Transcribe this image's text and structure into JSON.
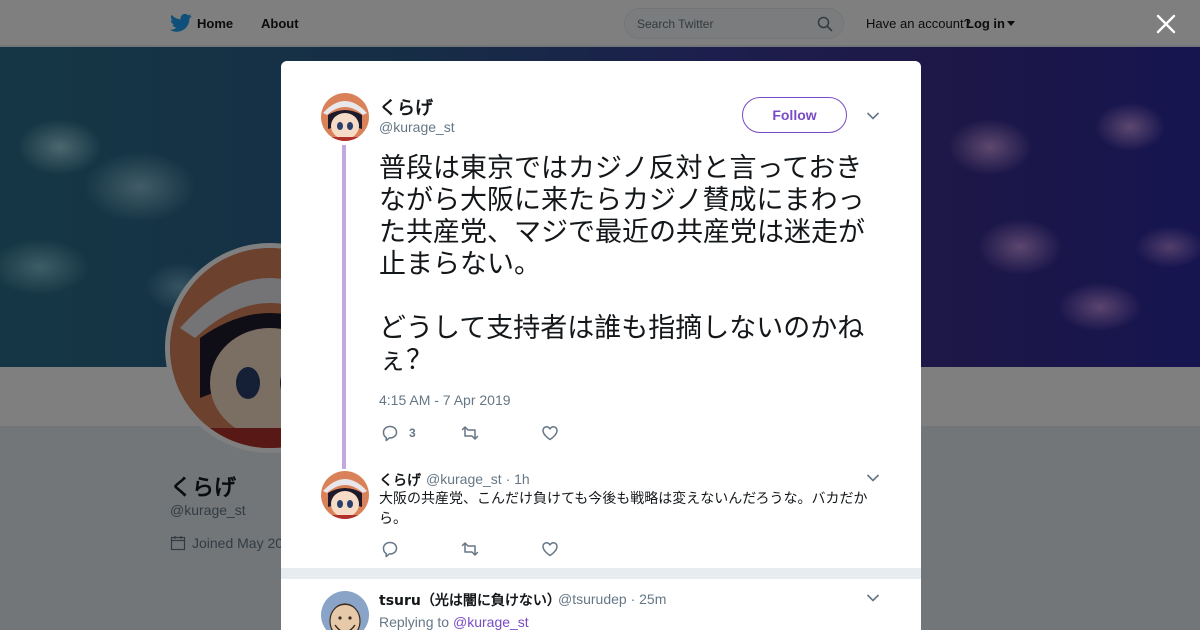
{
  "nav": {
    "home_label": "Home",
    "about_label": "About",
    "search_placeholder": "Search Twitter",
    "have_account": "Have an account?",
    "login_label": "Log in"
  },
  "profile": {
    "name": "くらげ",
    "handle": "@kurage_st",
    "joined": "Joined May 20"
  },
  "tweet": {
    "author_name": "くらげ",
    "author_handle": "@kurage_st",
    "follow_label": "Follow",
    "paragraph1": "普段は東京ではカジノ反対と言っておきながら大阪に来たらカジノ賛成にまわった共産党、マジで最近の共産党は迷走が止まらない。",
    "paragraph2": "どうして支持者は誰も指摘しないのかねぇ？",
    "timestamp": "4:15 AM - 7 Apr 2019",
    "reply_count": "3"
  },
  "reply": {
    "author_name": "くらげ",
    "meta": "@kurage_st · 1h",
    "text": "大阪の共産党、こんだけ負けても今後も戦略は変えないんだろうな。バカだから。"
  },
  "next_tweet": {
    "author_name": "tsuru（光は闇に負けない）",
    "meta": "@tsurudep · 25m",
    "replying_label": "Replying to",
    "replying_to": "@kurage_st"
  },
  "colors": {
    "accent": "#794bc4",
    "thread_line": "#c5a7e0",
    "secondary_text": "#657786"
  },
  "icons": [
    "twitter-bird-icon",
    "search-icon",
    "close-icon",
    "chevron-down-icon",
    "reply-icon",
    "retweet-icon",
    "like-icon",
    "calendar-icon"
  ]
}
